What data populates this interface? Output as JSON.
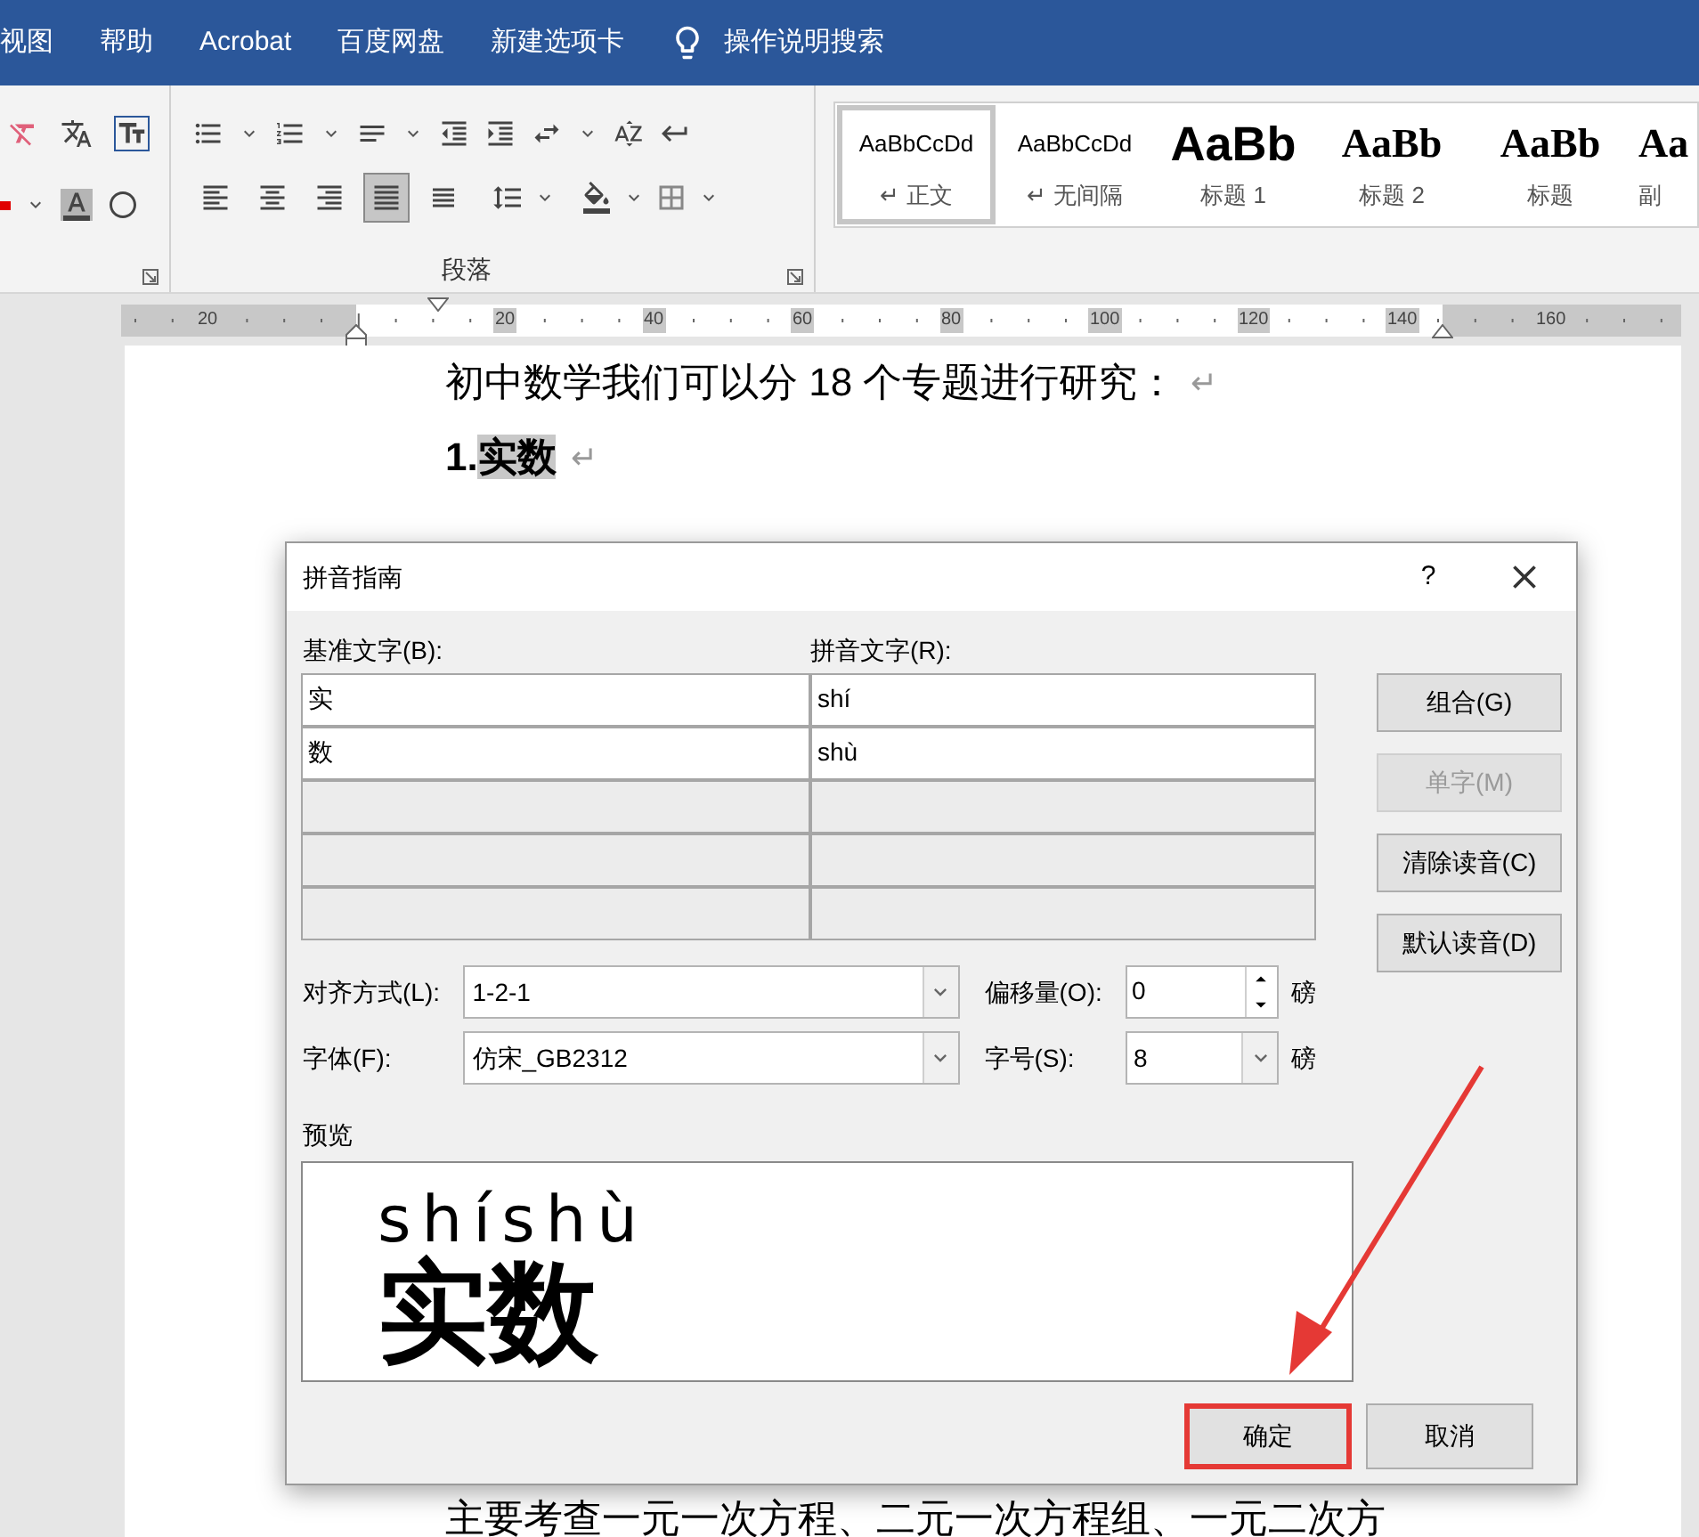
{
  "ribbon_tabs": [
    {
      "label": "视图"
    },
    {
      "label": "帮助"
    },
    {
      "label": "Acrobat"
    },
    {
      "label": "百度网盘"
    },
    {
      "label": "新建选项卡"
    }
  ],
  "tell_me": {
    "label": "操作说明搜索"
  },
  "paragraph_group": {
    "label": "段落",
    "alignment_buttons": [
      {
        "selected": false
      },
      {
        "selected": false
      },
      {
        "selected": false
      },
      {
        "selected": true
      },
      {
        "selected": false
      }
    ]
  },
  "styles": [
    {
      "preview": "AaBbCcDd",
      "name": "↵ 正文",
      "kind": "normal",
      "selected": true
    },
    {
      "preview": "AaBbCcDd",
      "name": "↵ 无间隔",
      "kind": "normal",
      "selected": false
    },
    {
      "preview": "AaBb",
      "name": "标题 1",
      "kind": "heading1",
      "selected": false
    },
    {
      "preview": "AaBb",
      "name": "标题 2",
      "kind": "heading2",
      "selected": false
    },
    {
      "preview": "AaBb",
      "name": "标题",
      "kind": "heading2",
      "selected": false
    },
    {
      "preview": "Aa",
      "name": "副",
      "kind": "heading2",
      "selected": false
    }
  ],
  "ruler": {
    "labels": [
      "20",
      "20",
      "40",
      "60",
      "80",
      "100",
      "120",
      "140",
      "160"
    ]
  },
  "document": {
    "paragraphs": [
      {
        "segments": [
          {
            "text": "初中数学我们可以分 18 个专题进行研究：",
            "selected": false
          }
        ],
        "bold": false,
        "mark": "↵"
      },
      {
        "segments": [
          {
            "text": "1.",
            "selected": false
          },
          {
            "text": "实数",
            "selected": true
          }
        ],
        "bold": true,
        "mark": "↵"
      }
    ],
    "last_line": "主要考查一元一次方程、二元一次方程组、一元二次方"
  },
  "dialog": {
    "title": "拼音指南",
    "help": "?",
    "base_label": "基准文字(B):",
    "ruby_label": "拼音文字(R):",
    "rows": [
      {
        "base": "实",
        "ruby": "shí",
        "disabled": false
      },
      {
        "base": "数",
        "ruby": "shù",
        "disabled": false
      },
      {
        "disabled": true
      },
      {
        "disabled": true
      },
      {
        "disabled": true
      }
    ],
    "side_buttons": [
      {
        "label": "组合(G)",
        "disabled": false
      },
      {
        "label": "单字(M)",
        "disabled": true
      },
      {
        "label": "清除读音(C)",
        "disabled": false
      },
      {
        "label": "默认读音(D)",
        "disabled": false
      }
    ],
    "alignment": {
      "label": "对齐方式(L):",
      "value": "1-2-1"
    },
    "offset": {
      "label": "偏移量(O):",
      "value": "0",
      "unit": "磅"
    },
    "font": {
      "label": "字体(F):",
      "value": "仿宋_GB2312"
    },
    "size": {
      "label": "字号(S):",
      "value": "8",
      "unit": "磅"
    },
    "preview": {
      "label": "预览",
      "ruby": "shíshù",
      "base": "实数"
    },
    "buttons": [
      {
        "label": "确定",
        "highlighted": true
      },
      {
        "label": "取消",
        "highlighted": false
      }
    ]
  }
}
